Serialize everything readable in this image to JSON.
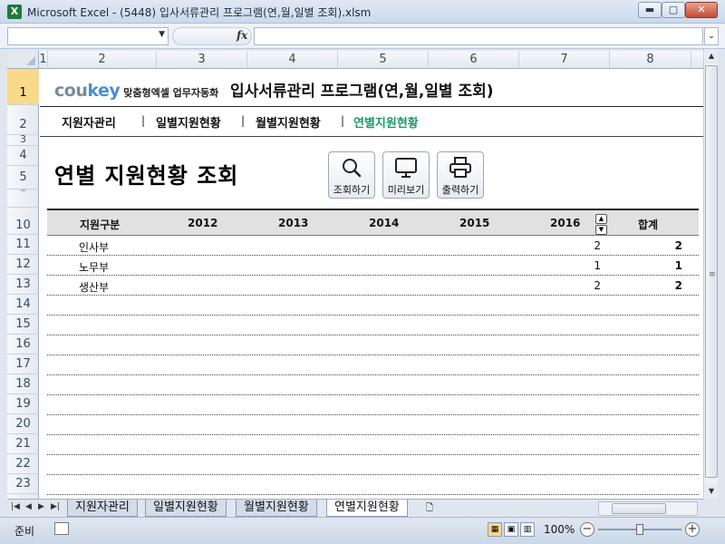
{
  "window": {
    "title": "Microsoft Excel - (5448) 입사서류관리 프로그램(연,월,일별 조회).xlsm",
    "app_icon": "X",
    "min_label": "▬",
    "max_label": "▢",
    "close_label": "✕"
  },
  "formula_bar": {
    "namebox_value": "",
    "fx_label": "fx",
    "formula_value": ""
  },
  "columns": [
    "1",
    "2",
    "3",
    "4",
    "5",
    "6",
    "7",
    "8"
  ],
  "rows": [
    "1",
    "2",
    "3",
    "4",
    "5",
    "10",
    "11",
    "12",
    "13",
    "14",
    "15",
    "16",
    "17",
    "18",
    "19",
    "20",
    "21",
    "22",
    "23"
  ],
  "header": {
    "brand_prefix": "cou",
    "brand_suffix": "key",
    "slogan": "맞춤형엑셀 업무자동화",
    "app_title": "입사서류관리 프로그램(연,월,일별 조회)"
  },
  "nav": {
    "items": [
      "지원자관리",
      "일별지원현황",
      "월별지원현황",
      "연별지원현황"
    ],
    "separator": "|"
  },
  "page_title": "연별 지원현황 조회",
  "toolbar": {
    "search_label": "조회하기",
    "preview_label": "미리보기",
    "print_label": "출력하기"
  },
  "table": {
    "headers": [
      "지원구분",
      "2012",
      "2013",
      "2014",
      "2015",
      "2016",
      "합계"
    ],
    "spin_up": "▲",
    "spin_down": "▼",
    "rows": [
      {
        "dept": "인사부",
        "v2016": "2",
        "total": "2"
      },
      {
        "dept": "노무부",
        "v2016": "1",
        "total": "1"
      },
      {
        "dept": "생산부",
        "v2016": "2",
        "total": "2"
      }
    ]
  },
  "sheet_tabs": [
    "지원자관리",
    "일별지원현황",
    "월별지원현황",
    "연별지원현황"
  ],
  "status": {
    "text": "준비",
    "zoom": "100%"
  },
  "colors": {
    "active_nav": "#1c9a6a",
    "selected_row_header": "#f9d98a"
  }
}
